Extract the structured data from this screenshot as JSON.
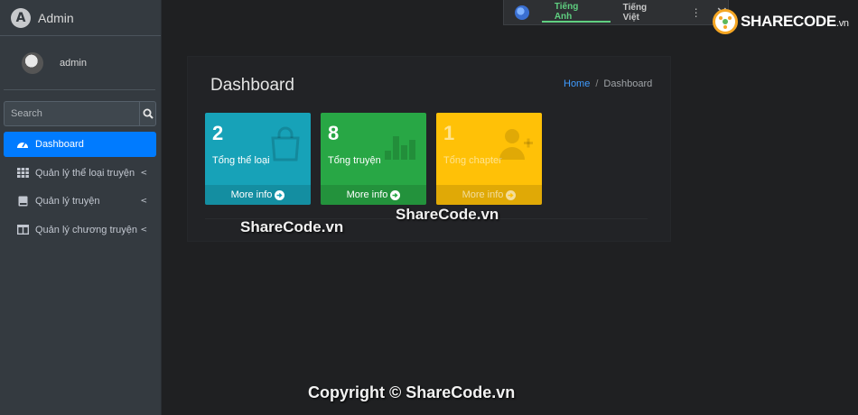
{
  "brand": {
    "logo_letter": "A",
    "title": "Admin"
  },
  "user": {
    "name": "admin"
  },
  "search": {
    "placeholder": "Search"
  },
  "nav": [
    {
      "label": "Dashboard",
      "icon": "dashboard-icon",
      "active": true
    },
    {
      "label": "Quản lý thể loại truyện",
      "icon": "grid-icon"
    },
    {
      "label": "Quản lý truyện",
      "icon": "book-icon"
    },
    {
      "label": "Quản lý chương truyện",
      "icon": "columns-icon"
    }
  ],
  "page": {
    "title": "Dashboard"
  },
  "breadcrumb": {
    "home": "Home",
    "separator": "/",
    "current": "Dashboard"
  },
  "boxes": [
    {
      "count": "2",
      "label": "Tổng thể loại",
      "footer": "More info",
      "color": "#17a2b8",
      "icon": "shopping-bag-icon"
    },
    {
      "count": "8",
      "label": "Tổng truyện",
      "footer": "More info",
      "color": "#28a745",
      "icon": "bar-chart-icon"
    },
    {
      "count": "1",
      "label": "Tổng chapter",
      "footer": "More info",
      "color": "#ffc107",
      "icon": "user-plus-icon"
    }
  ],
  "translate": {
    "tab_active": "Tiếng Anh",
    "tab_other": "Tiếng Việt",
    "more": "⋮",
    "close": "✕"
  },
  "watermark": {
    "logo_text": "SHARECODE",
    "logo_tld": ".vn",
    "center_1": "ShareCode.vn",
    "center_2": "ShareCode.vn",
    "copyright": "Copyright © ShareCode.vn"
  }
}
